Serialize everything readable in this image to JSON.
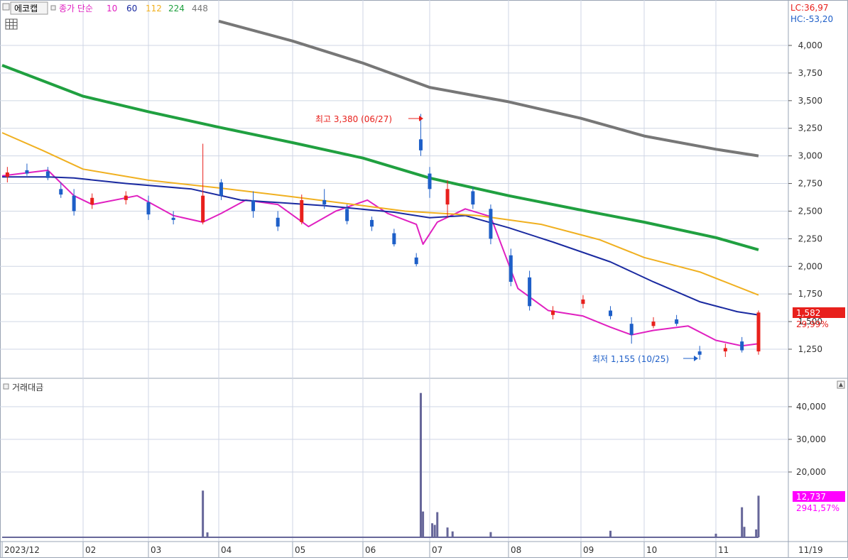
{
  "toolbar": {
    "name_button_label": "에코캡",
    "ma_label": "종가 단순",
    "ma_periods": [
      "10",
      "60",
      "112",
      "224",
      "448"
    ],
    "ma_colors": [
      "#e020c0",
      "#1a2aa0",
      "#f0b020",
      "#20a040",
      "#777777"
    ]
  },
  "top_right": {
    "lc": "LC:36,97",
    "hc": "HC:-53,20"
  },
  "price_badge": {
    "value": "1,582",
    "pct": "29,99%",
    "color": "#e8201c"
  },
  "volume_badge": {
    "value": "12,737",
    "pct": "2941,57%",
    "color": "#ff00ff"
  },
  "panel2_title": "거래대금",
  "x_label_last": "11/19",
  "colors": {
    "up": "#e8201c",
    "down": "#1e5fc8",
    "volume": "#666699",
    "grid": "#cfd6e4"
  },
  "chart_data": [
    {
      "type": "candlestick",
      "title": "에코캡",
      "x_tick_labels": [
        "2023/12",
        "02",
        "03",
        "04",
        "05",
        "06",
        "07",
        "08",
        "09",
        "10",
        "11"
      ],
      "y_ticks": [
        1250,
        1500,
        1750,
        2000,
        2250,
        2500,
        2750,
        3000,
        3250,
        3500,
        3750,
        4000
      ],
      "y_tick_labels": [
        "1,250",
        "1,500",
        "1,750",
        "2,000",
        "2,250",
        "2,500",
        "2,750",
        "3,000",
        "3,250",
        "3,500",
        "3,750",
        "4,000"
      ],
      "ylim": [
        1122,
        4270
      ],
      "annotations": [
        {
          "text": "최고 3,380 (06/27)",
          "value": 3380,
          "date": "06/27"
        },
        {
          "text": "최저 1,155 (10/25)",
          "value": 1155,
          "date": "10/25"
        }
      ],
      "last_close": 1582,
      "moving_averages": [
        {
          "name": "10",
          "color": "#e020c0",
          "points": [
            [
              "2023-12-01",
              2820
            ],
            [
              "2024-01-05",
              2870
            ],
            [
              "2024-01-25",
              2640
            ],
            [
              "2024-02-05",
              2560
            ],
            [
              "2024-02-25",
              2640
            ],
            [
              "2024-03-12",
              2460
            ],
            [
              "2024-03-25",
              2400
            ],
            [
              "2024-04-02",
              2480
            ],
            [
              "2024-04-12",
              2600
            ],
            [
              "2024-04-25",
              2560
            ],
            [
              "2024-05-08",
              2360
            ],
            [
              "2024-05-20",
              2500
            ],
            [
              "2024-06-03",
              2600
            ],
            [
              "2024-06-12",
              2480
            ],
            [
              "2024-06-25",
              2380
            ],
            [
              "2024-06-28",
              2200
            ],
            [
              "2024-07-04",
              2400
            ],
            [
              "2024-07-15",
              2520
            ],
            [
              "2024-07-25",
              2450
            ],
            [
              "2024-08-05",
              1800
            ],
            [
              "2024-08-18",
              1600
            ],
            [
              "2024-09-02",
              1550
            ],
            [
              "2024-09-15",
              1450
            ],
            [
              "2024-09-25",
              1380
            ],
            [
              "2024-10-05",
              1420
            ],
            [
              "2024-10-20",
              1460
            ],
            [
              "2024-11-01",
              1330
            ],
            [
              "2024-11-12",
              1280
            ],
            [
              "2024-11-19",
              1300
            ]
          ]
        },
        {
          "name": "60",
          "color": "#1a2aa0",
          "points": [
            [
              "2023-12-01",
              2810
            ],
            [
              "2024-01-05",
              2810
            ],
            [
              "2024-01-25",
              2800
            ],
            [
              "2024-02-20",
              2750
            ],
            [
              "2024-03-20",
              2700
            ],
            [
              "2024-04-10",
              2600
            ],
            [
              "2024-05-15",
              2550
            ],
            [
              "2024-06-15",
              2490
            ],
            [
              "2024-07-01",
              2440
            ],
            [
              "2024-07-15",
              2460
            ],
            [
              "2024-08-01",
              2350
            ],
            [
              "2024-08-20",
              2220
            ],
            [
              "2024-09-15",
              2040
            ],
            [
              "2024-10-05",
              1860
            ],
            [
              "2024-10-25",
              1680
            ],
            [
              "2024-11-10",
              1590
            ],
            [
              "2024-11-19",
              1560
            ]
          ]
        },
        {
          "name": "112",
          "color": "#f0b020",
          "points": [
            [
              "2023-12-01",
              3210
            ],
            [
              "2024-01-01",
              3050
            ],
            [
              "2024-02-01",
              2880
            ],
            [
              "2024-03-01",
              2780
            ],
            [
              "2024-04-01",
              2710
            ],
            [
              "2024-05-01",
              2630
            ],
            [
              "2024-06-01",
              2550
            ],
            [
              "2024-06-20",
              2500
            ],
            [
              "2024-07-20",
              2460
            ],
            [
              "2024-08-15",
              2380
            ],
            [
              "2024-09-10",
              2240
            ],
            [
              "2024-10-01",
              2080
            ],
            [
              "2024-10-25",
              1950
            ],
            [
              "2024-11-19",
              1740
            ]
          ]
        },
        {
          "name": "224",
          "color": "#20a040",
          "points": [
            [
              "2023-12-01",
              3820
            ],
            [
              "2024-01-01",
              3680
            ],
            [
              "2024-02-01",
              3540
            ],
            [
              "2024-03-01",
              3400
            ],
            [
              "2024-04-01",
              3260
            ],
            [
              "2024-05-01",
              3120
            ],
            [
              "2024-06-01",
              2980
            ],
            [
              "2024-07-01",
              2800
            ],
            [
              "2024-08-01",
              2640
            ],
            [
              "2024-09-01",
              2510
            ],
            [
              "2024-10-01",
              2400
            ],
            [
              "2024-11-01",
              2260
            ],
            [
              "2024-11-19",
              2150
            ]
          ]
        },
        {
          "name": "448",
          "color": "#777777",
          "points": [
            [
              "2024-04-01",
              4220
            ],
            [
              "2024-05-01",
              4040
            ],
            [
              "2024-06-01",
              3840
            ],
            [
              "2024-07-01",
              3620
            ],
            [
              "2024-08-01",
              3490
            ],
            [
              "2024-09-01",
              3340
            ],
            [
              "2024-10-01",
              3180
            ],
            [
              "2024-11-01",
              3060
            ],
            [
              "2024-11-19",
              3000
            ]
          ]
        }
      ],
      "candles": [
        {
          "d": "2023-12-05",
          "o": 2810,
          "h": 2900,
          "l": 2760,
          "c": 2850
        },
        {
          "d": "2023-12-20",
          "o": 2870,
          "h": 2930,
          "l": 2820,
          "c": 2840
        },
        {
          "d": "2024-01-05",
          "o": 2860,
          "h": 2900,
          "l": 2780,
          "c": 2800
        },
        {
          "d": "2024-01-15",
          "o": 2700,
          "h": 2760,
          "l": 2620,
          "c": 2650
        },
        {
          "d": "2024-01-25",
          "o": 2640,
          "h": 2700,
          "l": 2460,
          "c": 2500
        },
        {
          "d": "2024-02-05",
          "o": 2560,
          "h": 2660,
          "l": 2520,
          "c": 2620
        },
        {
          "d": "2024-02-20",
          "o": 2600,
          "h": 2680,
          "l": 2560,
          "c": 2640
        },
        {
          "d": "2024-03-01",
          "o": 2580,
          "h": 2640,
          "l": 2420,
          "c": 2470
        },
        {
          "d": "2024-03-12",
          "o": 2440,
          "h": 2500,
          "l": 2380,
          "c": 2420
        },
        {
          "d": "2024-03-25",
          "o": 2400,
          "h": 3110,
          "l": 2380,
          "c": 2640
        },
        {
          "d": "2024-04-02",
          "o": 2760,
          "h": 2790,
          "l": 2600,
          "c": 2640
        },
        {
          "d": "2024-04-15",
          "o": 2600,
          "h": 2680,
          "l": 2440,
          "c": 2500
        },
        {
          "d": "2024-04-25",
          "o": 2440,
          "h": 2500,
          "l": 2320,
          "c": 2360
        },
        {
          "d": "2024-05-05",
          "o": 2400,
          "h": 2650,
          "l": 2380,
          "c": 2600
        },
        {
          "d": "2024-05-15",
          "o": 2600,
          "h": 2700,
          "l": 2520,
          "c": 2560
        },
        {
          "d": "2024-05-25",
          "o": 2520,
          "h": 2560,
          "l": 2380,
          "c": 2410
        },
        {
          "d": "2024-06-05",
          "o": 2420,
          "h": 2450,
          "l": 2320,
          "c": 2360
        },
        {
          "d": "2024-06-15",
          "o": 2300,
          "h": 2340,
          "l": 2180,
          "c": 2200
        },
        {
          "d": "2024-06-25",
          "o": 2080,
          "h": 2120,
          "l": 2000,
          "c": 2020
        },
        {
          "d": "2024-06-27",
          "o": 3150,
          "h": 3380,
          "l": 3000,
          "c": 3050
        },
        {
          "d": "2024-07-01",
          "o": 2840,
          "h": 2900,
          "l": 2620,
          "c": 2700
        },
        {
          "d": "2024-07-08",
          "o": 2560,
          "h": 2780,
          "l": 2440,
          "c": 2700
        },
        {
          "d": "2024-07-18",
          "o": 2680,
          "h": 2720,
          "l": 2520,
          "c": 2560
        },
        {
          "d": "2024-07-25",
          "o": 2520,
          "h": 2560,
          "l": 2200,
          "c": 2250
        },
        {
          "d": "2024-08-02",
          "o": 2100,
          "h": 2160,
          "l": 1820,
          "c": 1860
        },
        {
          "d": "2024-08-10",
          "o": 1900,
          "h": 1960,
          "l": 1600,
          "c": 1640
        },
        {
          "d": "2024-08-20",
          "o": 1560,
          "h": 1640,
          "l": 1520,
          "c": 1600
        },
        {
          "d": "2024-09-02",
          "o": 1660,
          "h": 1740,
          "l": 1620,
          "c": 1700
        },
        {
          "d": "2024-09-15",
          "o": 1600,
          "h": 1640,
          "l": 1520,
          "c": 1550
        },
        {
          "d": "2024-09-25",
          "o": 1480,
          "h": 1540,
          "l": 1300,
          "c": 1380
        },
        {
          "d": "2024-10-05",
          "o": 1460,
          "h": 1540,
          "l": 1440,
          "c": 1500
        },
        {
          "d": "2024-10-15",
          "o": 1520,
          "h": 1560,
          "l": 1460,
          "c": 1480
        },
        {
          "d": "2024-10-25",
          "o": 1230,
          "h": 1280,
          "l": 1155,
          "c": 1200
        },
        {
          "d": "2024-11-05",
          "o": 1230,
          "h": 1300,
          "l": 1180,
          "c": 1260
        },
        {
          "d": "2024-11-12",
          "o": 1320,
          "h": 1360,
          "l": 1220,
          "c": 1240
        },
        {
          "d": "2024-11-19",
          "o": 1230,
          "h": 1600,
          "l": 1200,
          "c": 1582
        }
      ]
    },
    {
      "type": "bar",
      "title": "거래대금",
      "y_ticks": [
        20000,
        30000,
        40000
      ],
      "y_tick_labels": [
        "20,000",
        "30,000",
        "40,000"
      ],
      "ylim": [
        0,
        48000
      ],
      "last_value": 12737,
      "values": [
        {
          "d": "2024-03-25",
          "v": 14300
        },
        {
          "d": "2024-03-27",
          "v": 1500
        },
        {
          "d": "2024-06-27",
          "v": 44200
        },
        {
          "d": "2024-06-28",
          "v": 7900
        },
        {
          "d": "2024-07-02",
          "v": 4300
        },
        {
          "d": "2024-07-03",
          "v": 3800
        },
        {
          "d": "2024-07-04",
          "v": 7700
        },
        {
          "d": "2024-07-08",
          "v": 3000
        },
        {
          "d": "2024-07-10",
          "v": 1800
        },
        {
          "d": "2024-07-25",
          "v": 1600
        },
        {
          "d": "2024-09-15",
          "v": 2000
        },
        {
          "d": "2024-11-01",
          "v": 1100
        },
        {
          "d": "2024-11-12",
          "v": 9200
        },
        {
          "d": "2024-11-13",
          "v": 3200
        },
        {
          "d": "2024-11-18",
          "v": 2400
        },
        {
          "d": "2024-11-19",
          "v": 12737
        }
      ]
    }
  ]
}
